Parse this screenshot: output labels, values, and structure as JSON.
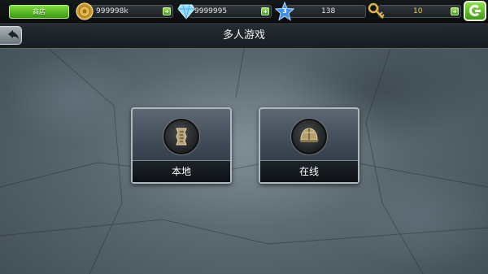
{
  "topbar": {
    "shop_label": "商店",
    "coins": "999998k",
    "diamonds": "9999995",
    "level": "3",
    "stars": "138",
    "keys": "10"
  },
  "titlebar": {
    "title": "多人游戏"
  },
  "modes": [
    {
      "label": "本地",
      "icon": "local-map-icon"
    },
    {
      "label": "在线",
      "icon": "online-helmet-icon"
    }
  ],
  "colors": {
    "accent_green": "#4da81c",
    "gold": "#e0b64a",
    "diamond": "#7fd6ff",
    "star_blue": "#3f8fe8"
  }
}
